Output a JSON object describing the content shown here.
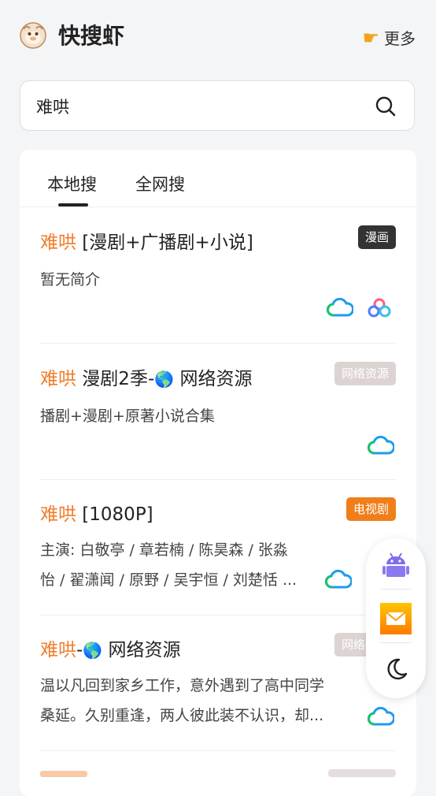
{
  "header": {
    "title": "快搜虾",
    "more_label": "更多",
    "more_icon": "pointing-hand-icon"
  },
  "search": {
    "value": "难哄",
    "placeholder": ""
  },
  "tabs": [
    {
      "label": "本地搜",
      "active": true
    },
    {
      "label": "全网搜",
      "active": false
    }
  ],
  "colors": {
    "highlight": "#f07c2a",
    "badge_dark": "#333333",
    "badge_pink": "#ddd3d3",
    "badge_orange": "#f07f1b"
  },
  "results": [
    {
      "highlight": "难哄",
      "rest": " [漫剧+广播剧+小说]",
      "badge": "漫画",
      "desc": "暂无简介",
      "clouds": [
        "baidu-cloud-icon",
        "quark-cloud-icon"
      ]
    },
    {
      "highlight": "难哄",
      "rest_a": " 漫剧2季-",
      "rest_b": " 网络资源",
      "badge": "网络资源",
      "desc": "播剧+漫剧+原著小说合集",
      "clouds": [
        "baidu-cloud-icon"
      ]
    },
    {
      "highlight": "难哄",
      "rest": " [1080P]",
      "badge": "电视剧",
      "desc_line1": "主演: 白敬亭 / 章若楠 / 陈昊森 / 张淼",
      "desc_line2": "怡 / 翟潇闻 / 原野 / 吴宇恒 / 刘楚恬 ...",
      "clouds": [
        "baidu-cloud-icon"
      ]
    },
    {
      "highlight": "难哄",
      "rest_a": "-",
      "rest_b": " 网络资源",
      "badge": "网络资源",
      "desc_line1": "温以凡回到家乡工作，意外遇到了高中同学",
      "desc_line2": "桑延。久别重逢，两人彼此装不认识，却...",
      "clouds": [
        "baidu-cloud-icon"
      ]
    }
  ],
  "floating_actions": [
    "android-icon",
    "mail-icon",
    "moon-icon"
  ]
}
